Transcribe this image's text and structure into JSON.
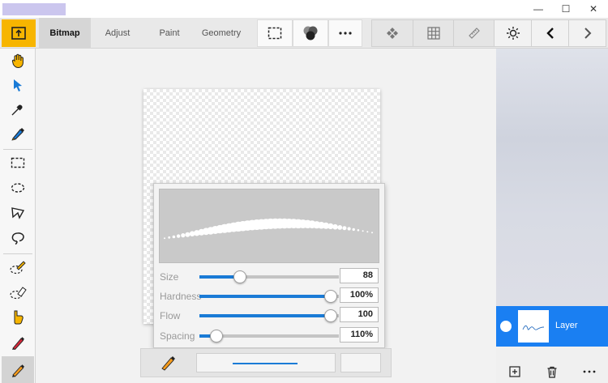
{
  "toolbar": {
    "tabs": [
      {
        "label": "Bitmap",
        "active": true
      },
      {
        "label": "Adjust",
        "active": false
      },
      {
        "label": "Paint",
        "active": false
      },
      {
        "label": "Geometry",
        "active": false
      }
    ],
    "icons": [
      "export-icon",
      "selection-icon",
      "blend-icon",
      "more-icon",
      "layers-diamond-icon",
      "grid-icon",
      "ruler-icon",
      "brightness-icon",
      "back-icon",
      "forward-icon"
    ]
  },
  "window": {
    "minimize_glyph": "—",
    "maximize_glyph": "☐",
    "close_glyph": "✕"
  },
  "brush": {
    "params": [
      {
        "label": "Size",
        "value": "88",
        "fraction": 0.29
      },
      {
        "label": "Hardness",
        "value": "100%",
        "fraction": 0.94
      },
      {
        "label": "Flow",
        "value": "100",
        "fraction": 0.94
      },
      {
        "label": "Spacing",
        "value": "110%",
        "fraction": 0.12
      }
    ]
  },
  "layers": {
    "items": [
      {
        "name": "Layer",
        "selected": true
      }
    ]
  },
  "colors": {
    "accent": "#1a7bd6",
    "home": "#f7b500",
    "layer_selected": "#1a7ff2"
  }
}
